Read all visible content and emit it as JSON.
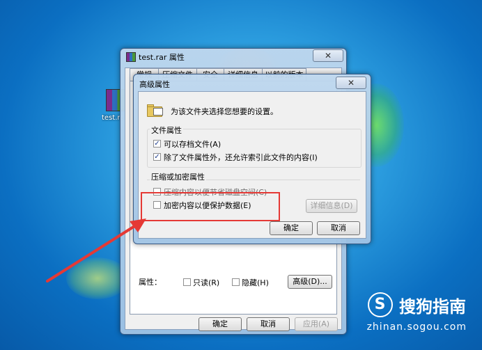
{
  "desktop": {
    "icon_label": "test.rar"
  },
  "properties_window": {
    "title": "test.rar 属性",
    "close_glyph": "✕",
    "tabs": [
      "常规",
      "压缩文件",
      "安全",
      "详细信息",
      "以前的版本"
    ],
    "attributes_label": "属性：",
    "readonly_label": "只读(R)",
    "hidden_label": "隐藏(H)",
    "advanced_button": "高级(D)...",
    "ok_button": "确定",
    "cancel_button": "取消",
    "apply_button": "应用(A)"
  },
  "advanced_dialog": {
    "title": "高级属性",
    "close_glyph": "✕",
    "intro": "为该文件夹选择您想要的设置。",
    "file_attributes_group": "文件属性",
    "archive_label": "可以存档文件(A)",
    "archive_checked": true,
    "index_label": "除了文件属性外，还允许索引此文件的内容(I)",
    "index_checked": true,
    "compress_encrypt_group": "压缩或加密属性",
    "compress_label": "压缩内容以便节省磁盘空间(C)",
    "compress_checked": false,
    "encrypt_label": "加密内容以便保护数据(E)",
    "encrypt_checked": false,
    "details_button": "详细信息(D)",
    "ok_button": "确定",
    "cancel_button": "取消",
    "check_glyph": "✓"
  },
  "watermark": {
    "logo": "S",
    "brand": "搜狗指南",
    "url": "zhinan.sogou.com"
  },
  "colors": {
    "highlight": "#e53935"
  }
}
